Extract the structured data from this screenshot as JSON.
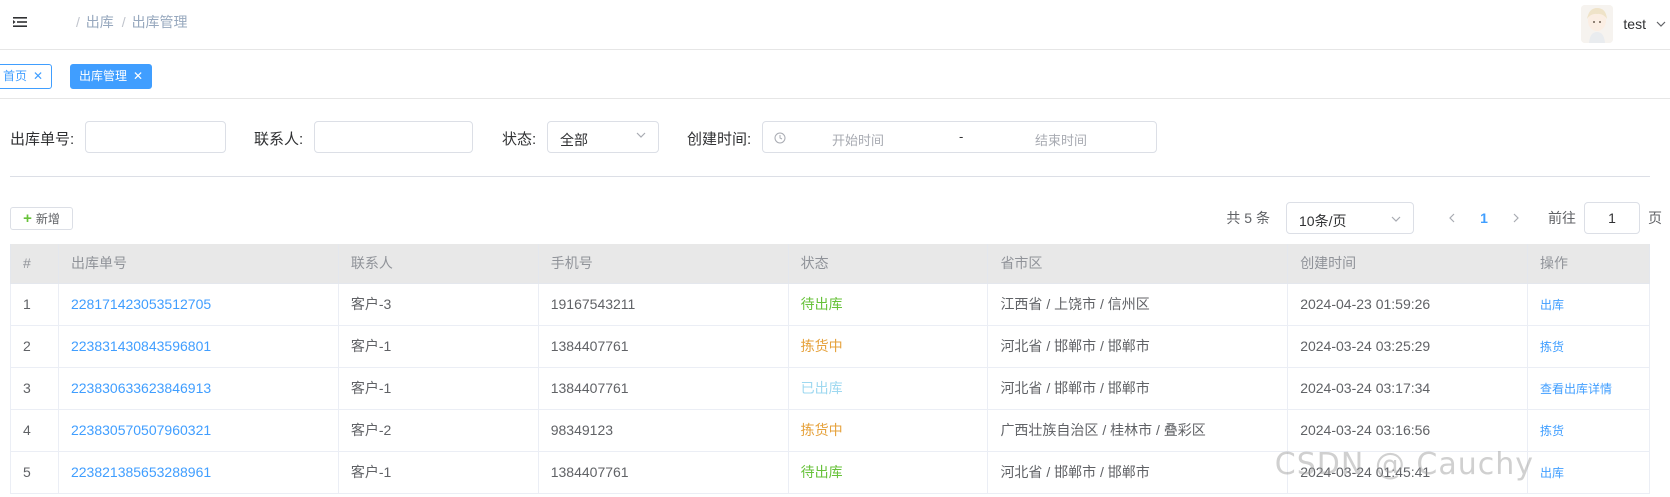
{
  "header": {
    "breadcrumb": [
      "出库",
      "出库管理"
    ],
    "breadcrumb_sep": "/",
    "username": "test"
  },
  "tags": {
    "home": "首页",
    "active": "出库管理"
  },
  "search": {
    "order_no_label": "出库单号:",
    "contact_label": "联系人:",
    "status_label": "状态:",
    "status_value": "全部",
    "created_label": "创建时间:",
    "start_placeholder": "开始时间",
    "range_sep": "-",
    "end_placeholder": "结束时间"
  },
  "toolbar": {
    "add_label": "新增"
  },
  "pager": {
    "total": "共 5 条",
    "page_size": "10条/页",
    "current_page": "1",
    "goto_label": "前往",
    "goto_value": "1",
    "page_suffix": "页"
  },
  "table": {
    "columns": [
      "#",
      "出库单号",
      "联系人",
      "手机号",
      "状态",
      "省市区",
      "创建时间",
      "操作"
    ],
    "rows": [
      {
        "index": "1",
        "order_no": "228171423053512705",
        "contact": "客户-3",
        "phone": "19167543211",
        "status": "待出库",
        "status_color": "#67c23a",
        "region": "江西省 / 上饶市 / 信州区",
        "created": "2024-04-23 01:59:26",
        "op": "出库"
      },
      {
        "index": "2",
        "order_no": "223831430843596801",
        "contact": "客户-1",
        "phone": "1384407761",
        "status": "拣货中",
        "status_color": "#e6a23c",
        "region": "河北省 / 邯郸市 / 邯郸市",
        "created": "2024-03-24 03:25:29",
        "op": "拣货"
      },
      {
        "index": "3",
        "order_no": "223830633623846913",
        "contact": "客户-1",
        "phone": "1384407761",
        "status": "已出库",
        "status_color": "#9ed8f0",
        "region": "河北省 / 邯郸市 / 邯郸市",
        "created": "2024-03-24 03:17:34",
        "op": "查看出库详情"
      },
      {
        "index": "4",
        "order_no": "223830570507960321",
        "contact": "客户-2",
        "phone": "98349123",
        "status": "拣货中",
        "status_color": "#e6a23c",
        "region": "广西壮族自治区 / 桂林市 / 叠彩区",
        "created": "2024-03-24 03:16:56",
        "op": "拣货"
      },
      {
        "index": "5",
        "order_no": "223821385653288961",
        "contact": "客户-1",
        "phone": "1384407761",
        "status": "待出库",
        "status_color": "#67c23a",
        "region": "河北省 / 邯郸市 / 邯郸市",
        "created": "2024-03-24 01:45:41",
        "op": "出库"
      }
    ]
  },
  "watermark": "CSDN @ Cauchy"
}
